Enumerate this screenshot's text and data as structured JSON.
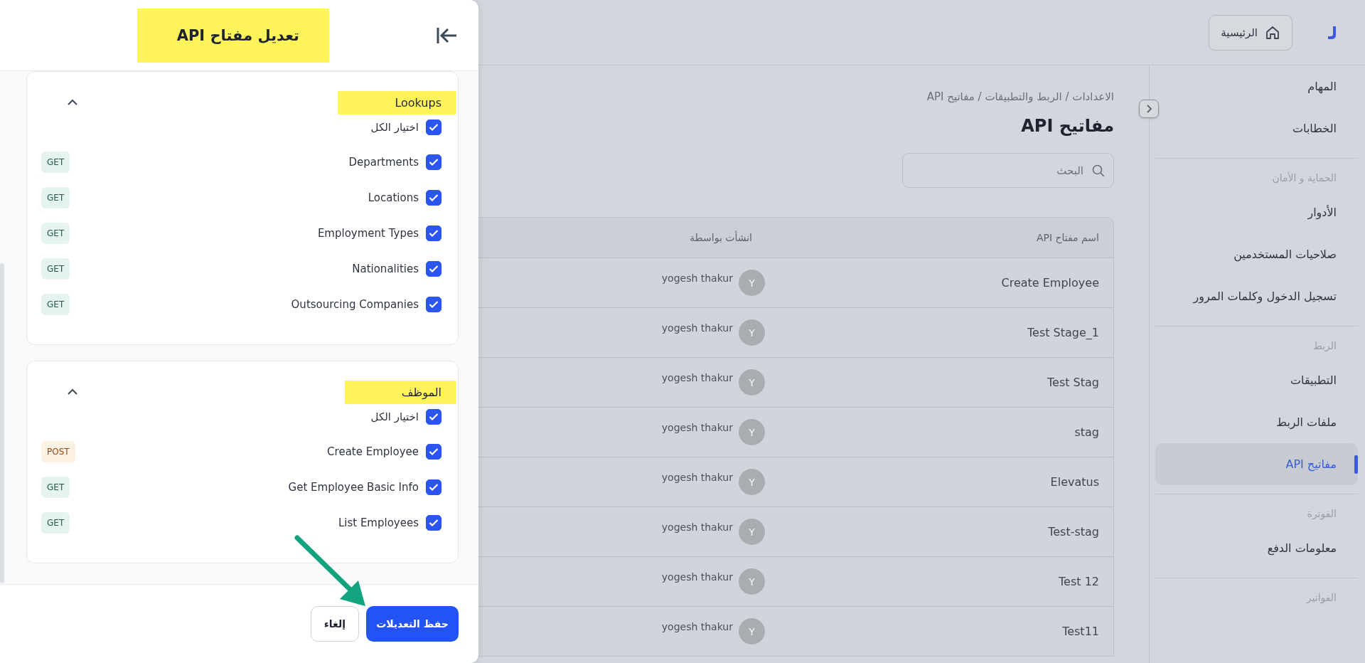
{
  "topbar": {
    "home_label": "الرئيسية"
  },
  "page": {
    "breadcrumb": "الاعدادات / الربط والتطبيقات / مفاتيح API",
    "title": "مفاتيح API",
    "search": {
      "placeholder": "البحث"
    }
  },
  "table": {
    "columns": [
      "اسم مفتاح API",
      "انشأت بواسطة"
    ],
    "rows": [
      {
        "name": "Create Employee",
        "created_by": "yogesh thakur",
        "avatar": "Y"
      },
      {
        "name": "Test Stage_1",
        "created_by": "yogesh thakur",
        "avatar": "Y"
      },
      {
        "name": "Test Stag",
        "created_by": "yogesh thakur",
        "avatar": "Y"
      },
      {
        "name": "stag",
        "created_by": "yogesh thakur",
        "avatar": "Y"
      },
      {
        "name": "Elevatus",
        "created_by": "yogesh thakur",
        "avatar": "Y"
      },
      {
        "name": "Test-stag",
        "created_by": "yogesh thakur",
        "avatar": "Y"
      },
      {
        "name": "Test 12",
        "created_by": "yogesh thakur",
        "avatar": "Y"
      },
      {
        "name": "Test11",
        "created_by": "yogesh thakur",
        "avatar": "Y"
      }
    ]
  },
  "sidebar": {
    "groups": [
      {
        "items": [
          {
            "label": "المهام",
            "selected": false
          },
          {
            "label": "الخطابات",
            "selected": false
          }
        ]
      },
      {
        "heading": "الحماية و الأمان",
        "items": [
          {
            "label": "الأدوار",
            "selected": false
          },
          {
            "label": "صلاحيات المستخدمين",
            "selected": false
          },
          {
            "label": "تسجيل الدخول وكلمات المرور",
            "selected": false
          }
        ]
      },
      {
        "heading": "الربط",
        "items": [
          {
            "label": "التطبيقات",
            "selected": false
          },
          {
            "label": "ملفات الربط",
            "selected": false
          },
          {
            "label": "مفاتيح API",
            "selected": true
          }
        ]
      },
      {
        "heading": "الفوترة",
        "items": [
          {
            "label": "معلومات الدفع",
            "selected": false
          }
        ]
      },
      {
        "heading": "الفواتير"
      }
    ]
  },
  "drawer": {
    "title": "تعديل مفتاح API",
    "title_highlighted": true,
    "sections": [
      {
        "title": "Lookups",
        "highlighted": true,
        "expanded": true,
        "select_all": {
          "label": "اختيار الكل",
          "checked": true
        },
        "endpoints": [
          {
            "label": "Departments",
            "checked": true,
            "method": "GET",
            "kind": "get"
          },
          {
            "label": "Locations",
            "checked": true,
            "method": "GET",
            "kind": "get"
          },
          {
            "label": "Employment Types",
            "checked": true,
            "method": "GET",
            "kind": "get"
          },
          {
            "label": "Nationalities",
            "checked": true,
            "method": "GET",
            "kind": "get"
          },
          {
            "label": "Outsourcing Companies",
            "checked": true,
            "method": "GET",
            "kind": "get"
          }
        ]
      },
      {
        "title": "الموظف",
        "highlighted": true,
        "expanded": true,
        "select_all": {
          "label": "اختيار الكل",
          "checked": true
        },
        "endpoints": [
          {
            "label": "Create Employee",
            "checked": true,
            "method": "POST",
            "kind": "post"
          },
          {
            "label": "Get Employee Basic Info",
            "checked": true,
            "method": "GET",
            "kind": "get"
          },
          {
            "label": "List Employees",
            "checked": true,
            "method": "GET",
            "kind": "get"
          }
        ]
      }
    ],
    "cancel": "إلغاء",
    "save": "حفظ التعديلات"
  }
}
